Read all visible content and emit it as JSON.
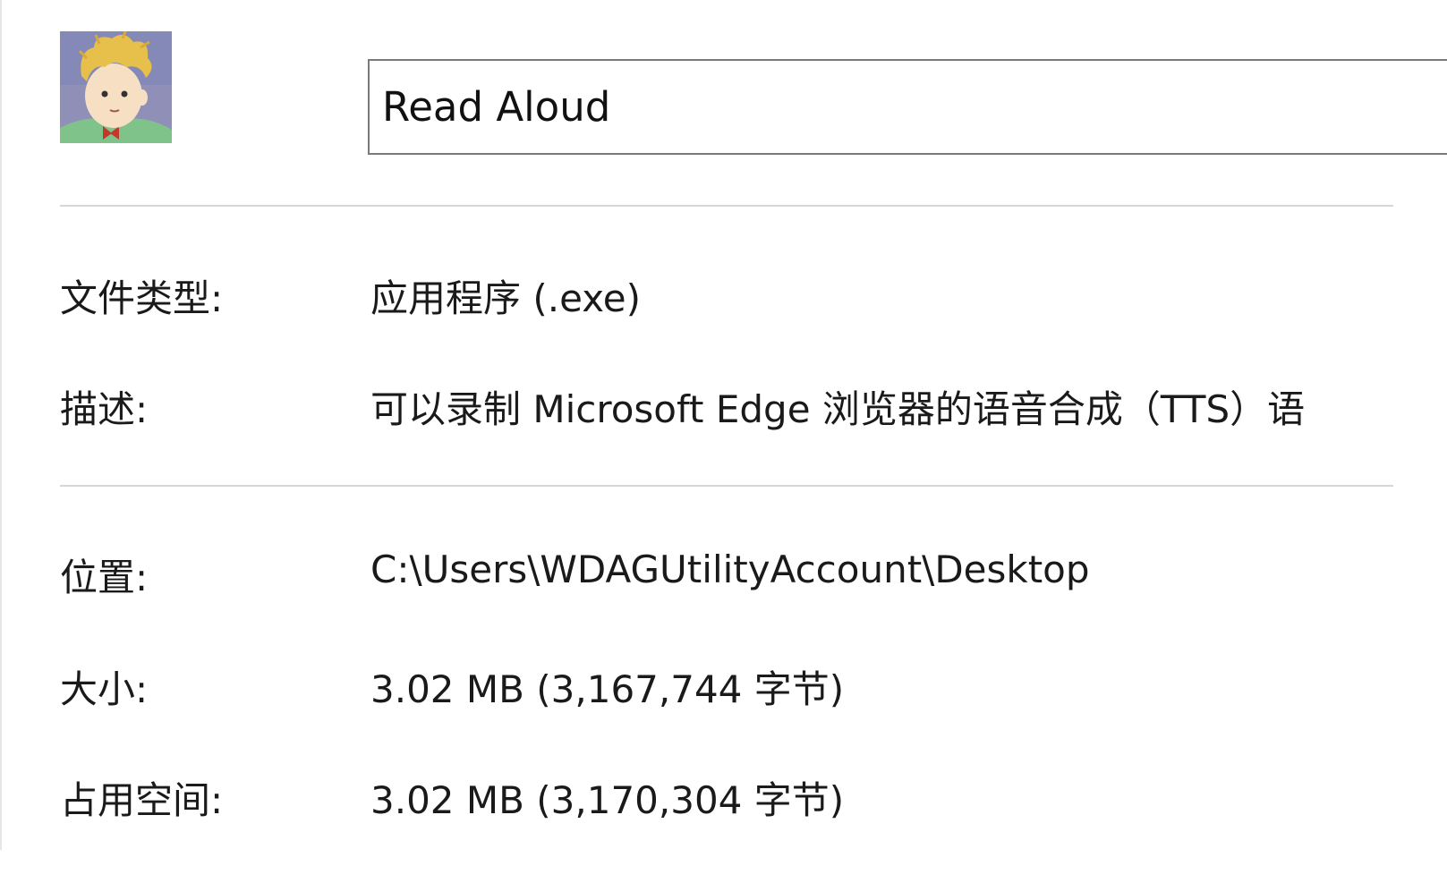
{
  "file": {
    "name": "Read Aloud",
    "icon": "app-icon-boy-portrait"
  },
  "properties": {
    "type": {
      "label": "文件类型:",
      "value": "应用程序 (.exe)"
    },
    "description": {
      "label": "描述:",
      "value": "可以录制 Microsoft Edge 浏览器的语音合成（TTS）语"
    },
    "location": {
      "label": "位置:",
      "value": "C:\\Users\\WDAGUtilityAccount\\Desktop"
    },
    "size": {
      "label": "大小:",
      "value": "3.02 MB (3,167,744 字节)"
    },
    "size_on_disk": {
      "label": "占用空间:",
      "value": "3.02 MB (3,170,304 字节)"
    }
  },
  "colors": {
    "field_border": "#7a7a7a",
    "divider": "#d6d6d6",
    "text": "#1a1a1a"
  }
}
